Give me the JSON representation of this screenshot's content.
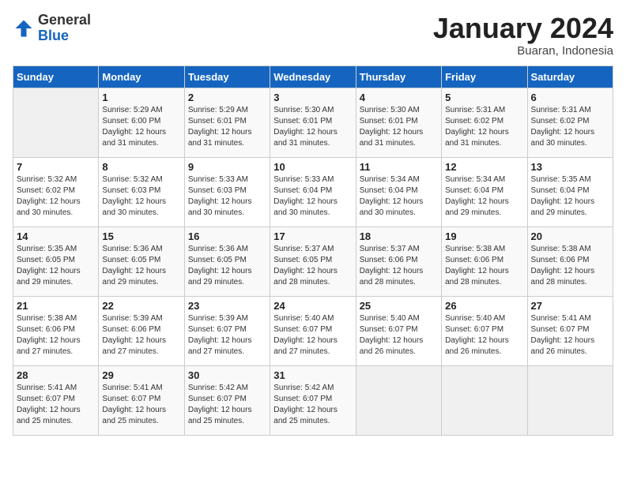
{
  "header": {
    "logo_general": "General",
    "logo_blue": "Blue",
    "month_title": "January 2024",
    "location": "Buaran, Indonesia"
  },
  "calendar": {
    "days_of_week": [
      "Sunday",
      "Monday",
      "Tuesday",
      "Wednesday",
      "Thursday",
      "Friday",
      "Saturday"
    ],
    "weeks": [
      [
        {
          "day": "",
          "info": ""
        },
        {
          "day": "1",
          "info": "Sunrise: 5:29 AM\nSunset: 6:00 PM\nDaylight: 12 hours\nand 31 minutes."
        },
        {
          "day": "2",
          "info": "Sunrise: 5:29 AM\nSunset: 6:01 PM\nDaylight: 12 hours\nand 31 minutes."
        },
        {
          "day": "3",
          "info": "Sunrise: 5:30 AM\nSunset: 6:01 PM\nDaylight: 12 hours\nand 31 minutes."
        },
        {
          "day": "4",
          "info": "Sunrise: 5:30 AM\nSunset: 6:01 PM\nDaylight: 12 hours\nand 31 minutes."
        },
        {
          "day": "5",
          "info": "Sunrise: 5:31 AM\nSunset: 6:02 PM\nDaylight: 12 hours\nand 31 minutes."
        },
        {
          "day": "6",
          "info": "Sunrise: 5:31 AM\nSunset: 6:02 PM\nDaylight: 12 hours\nand 30 minutes."
        }
      ],
      [
        {
          "day": "7",
          "info": "Sunrise: 5:32 AM\nSunset: 6:02 PM\nDaylight: 12 hours\nand 30 minutes."
        },
        {
          "day": "8",
          "info": "Sunrise: 5:32 AM\nSunset: 6:03 PM\nDaylight: 12 hours\nand 30 minutes."
        },
        {
          "day": "9",
          "info": "Sunrise: 5:33 AM\nSunset: 6:03 PM\nDaylight: 12 hours\nand 30 minutes."
        },
        {
          "day": "10",
          "info": "Sunrise: 5:33 AM\nSunset: 6:04 PM\nDaylight: 12 hours\nand 30 minutes."
        },
        {
          "day": "11",
          "info": "Sunrise: 5:34 AM\nSunset: 6:04 PM\nDaylight: 12 hours\nand 30 minutes."
        },
        {
          "day": "12",
          "info": "Sunrise: 5:34 AM\nSunset: 6:04 PM\nDaylight: 12 hours\nand 29 minutes."
        },
        {
          "day": "13",
          "info": "Sunrise: 5:35 AM\nSunset: 6:04 PM\nDaylight: 12 hours\nand 29 minutes."
        }
      ],
      [
        {
          "day": "14",
          "info": "Sunrise: 5:35 AM\nSunset: 6:05 PM\nDaylight: 12 hours\nand 29 minutes."
        },
        {
          "day": "15",
          "info": "Sunrise: 5:36 AM\nSunset: 6:05 PM\nDaylight: 12 hours\nand 29 minutes."
        },
        {
          "day": "16",
          "info": "Sunrise: 5:36 AM\nSunset: 6:05 PM\nDaylight: 12 hours\nand 29 minutes."
        },
        {
          "day": "17",
          "info": "Sunrise: 5:37 AM\nSunset: 6:05 PM\nDaylight: 12 hours\nand 28 minutes."
        },
        {
          "day": "18",
          "info": "Sunrise: 5:37 AM\nSunset: 6:06 PM\nDaylight: 12 hours\nand 28 minutes."
        },
        {
          "day": "19",
          "info": "Sunrise: 5:38 AM\nSunset: 6:06 PM\nDaylight: 12 hours\nand 28 minutes."
        },
        {
          "day": "20",
          "info": "Sunrise: 5:38 AM\nSunset: 6:06 PM\nDaylight: 12 hours\nand 28 minutes."
        }
      ],
      [
        {
          "day": "21",
          "info": "Sunrise: 5:38 AM\nSunset: 6:06 PM\nDaylight: 12 hours\nand 27 minutes."
        },
        {
          "day": "22",
          "info": "Sunrise: 5:39 AM\nSunset: 6:06 PM\nDaylight: 12 hours\nand 27 minutes."
        },
        {
          "day": "23",
          "info": "Sunrise: 5:39 AM\nSunset: 6:07 PM\nDaylight: 12 hours\nand 27 minutes."
        },
        {
          "day": "24",
          "info": "Sunrise: 5:40 AM\nSunset: 6:07 PM\nDaylight: 12 hours\nand 27 minutes."
        },
        {
          "day": "25",
          "info": "Sunrise: 5:40 AM\nSunset: 6:07 PM\nDaylight: 12 hours\nand 26 minutes."
        },
        {
          "day": "26",
          "info": "Sunrise: 5:40 AM\nSunset: 6:07 PM\nDaylight: 12 hours\nand 26 minutes."
        },
        {
          "day": "27",
          "info": "Sunrise: 5:41 AM\nSunset: 6:07 PM\nDaylight: 12 hours\nand 26 minutes."
        }
      ],
      [
        {
          "day": "28",
          "info": "Sunrise: 5:41 AM\nSunset: 6:07 PM\nDaylight: 12 hours\nand 25 minutes."
        },
        {
          "day": "29",
          "info": "Sunrise: 5:41 AM\nSunset: 6:07 PM\nDaylight: 12 hours\nand 25 minutes."
        },
        {
          "day": "30",
          "info": "Sunrise: 5:42 AM\nSunset: 6:07 PM\nDaylight: 12 hours\nand 25 minutes."
        },
        {
          "day": "31",
          "info": "Sunrise: 5:42 AM\nSunset: 6:07 PM\nDaylight: 12 hours\nand 25 minutes."
        },
        {
          "day": "",
          "info": ""
        },
        {
          "day": "",
          "info": ""
        },
        {
          "day": "",
          "info": ""
        }
      ]
    ]
  }
}
